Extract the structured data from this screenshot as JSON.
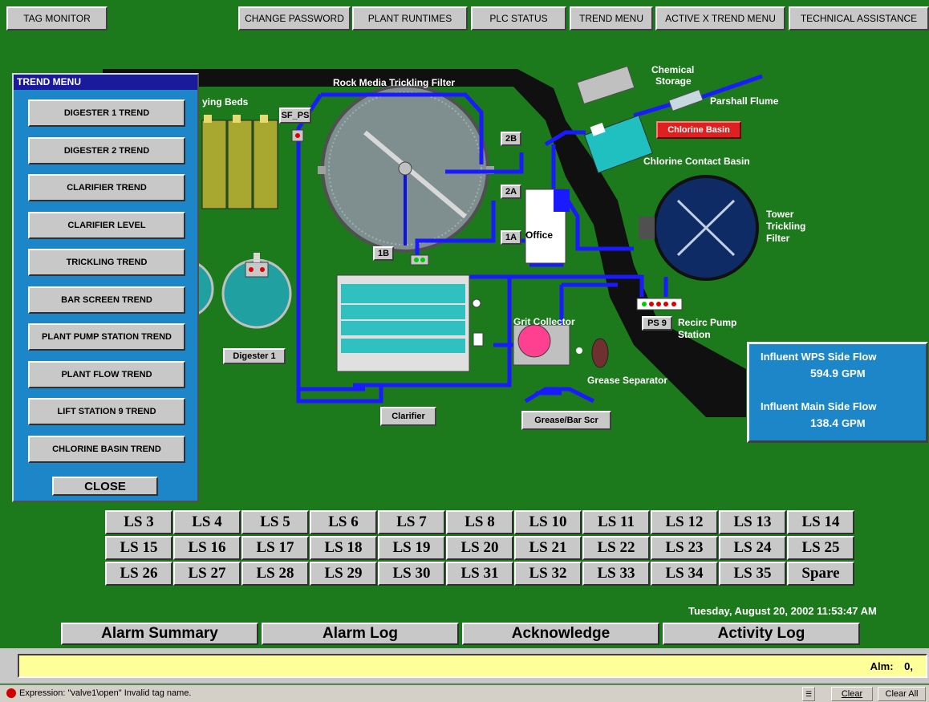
{
  "top_nav": {
    "tag_monitor": "TAG MONITOR",
    "items": [
      "CHANGE PASSWORD",
      "PLANT RUNTIMES",
      "PLC STATUS",
      "TREND MENU",
      "ACTIVE X TREND MENU",
      "TECHNICAL ASSISTANCE"
    ]
  },
  "plant": {
    "labels": {
      "rock_media": "Rock Media Trickling Filter",
      "drying_beds": "ying Beds",
      "chemical_storage_1": "Chemical",
      "chemical_storage_2": "Storage",
      "parshall_flume": "Parshall Flume",
      "chlorine_contact": "Chlorine Contact Basin",
      "tower_1": "Tower",
      "tower_2": "Trickling",
      "tower_3": "Filter",
      "grit_collector": "Grit Collector",
      "grease_separator": "Grease Separator",
      "recirc_1": "Recirc Pump",
      "recirc_2": "Station",
      "office": "Office"
    },
    "buttons": {
      "sf_ps": "SF_PS",
      "b2b": "2B",
      "b2a": "2A",
      "b1a": "1A",
      "b1b": "1B",
      "ps9": "PS 9",
      "chlorine_basin": "Chlorine Basin",
      "digester1": "Digester 1",
      "clarifier": "Clarifier",
      "grease_bar": "Grease/Bar Scr"
    }
  },
  "trend_menu": {
    "title": "TREND MENU",
    "items": [
      "DIGESTER 1 TREND",
      "DIGESTER 2 TREND",
      "CLARIFIER TREND",
      "CLARIFIER LEVEL",
      "TRICKLING TREND",
      "BAR SCREEN TREND",
      "PLANT PUMP STATION TREND",
      "PLANT FLOW TREND",
      "LIFT STATION 9 TREND",
      "CHLORINE BASIN TREND"
    ],
    "close": "CLOSE"
  },
  "flow_panel": {
    "wps_label": "Influent WPS Side Flow",
    "wps_value": "594.9",
    "wps_unit": "GPM",
    "main_label": "Influent Main Side Flow",
    "main_value": "138.4",
    "main_unit": "GPM"
  },
  "lift_stations": [
    [
      "LS 3",
      "LS 4",
      "LS 5",
      "LS 6",
      "LS 7",
      "LS 8",
      "LS 10",
      "LS 11",
      "LS 12",
      "LS 13",
      "LS 14"
    ],
    [
      "LS 15",
      "LS 16",
      "LS 17",
      "LS 18",
      "LS 19",
      "LS 20",
      "LS 21",
      "LS 22",
      "LS 23",
      "LS 24",
      "LS 25"
    ],
    [
      "LS 26",
      "LS 27",
      "LS 28",
      "LS 29",
      "LS 30",
      "LS 31",
      "LS 32",
      "LS 33",
      "LS 34",
      "LS 35",
      "Spare"
    ]
  ],
  "datetime": "Tuesday, August 20, 2002  11:53:47 AM",
  "alarm_buttons": [
    "Alarm Summary",
    "Alarm Log",
    "Acknowledge",
    "Activity Log"
  ],
  "alarm_bar": {
    "alm_label": "Alm:",
    "alm_value": "0,"
  },
  "status_bar": {
    "message": "Expression: \"valve1\\open\"  Invalid tag name.",
    "clear": "Clear",
    "clear_all": "Clear All"
  }
}
